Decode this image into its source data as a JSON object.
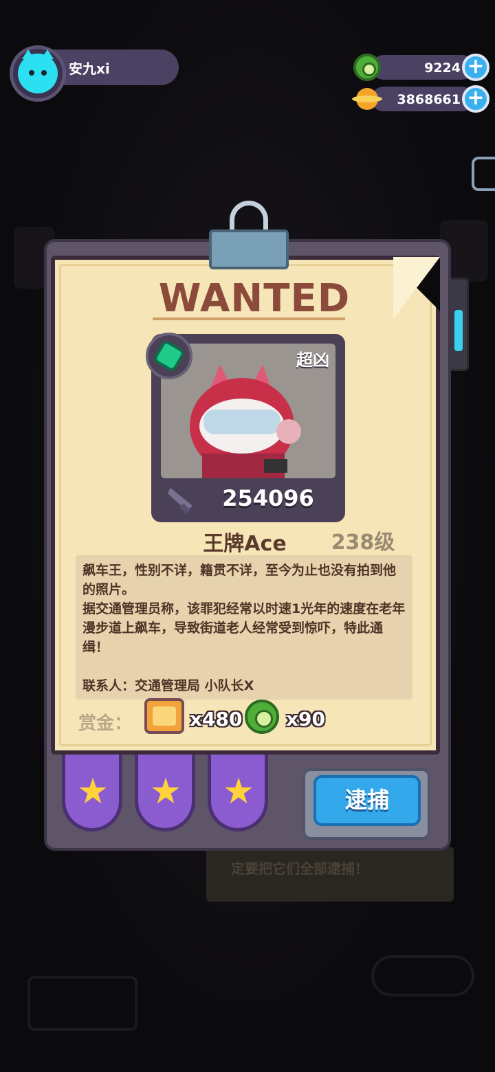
{
  "player": {
    "name": "安九xi"
  },
  "currencies": [
    {
      "name": "green-coin",
      "value": "9224"
    },
    {
      "name": "planet-coin",
      "value": "3868661"
    }
  ],
  "poster": {
    "heading": "WANTED",
    "tier": "超凶",
    "power": "254096",
    "character_name": "王牌Ace",
    "level": "238级",
    "description": "飙车王，性别不详，籍贯不详，至今为止也没有拍到他的照片。\n据交通管理员称，该罪犯经常以时速1光年的速度在老年漫步道上飙车，导致街道老人经常受到惊吓，特此通缉！\n\n联系人：交通管理局 小队长X",
    "reward_label": "赏金：",
    "rewards": [
      {
        "icon": "chip-icon",
        "qty": "x480"
      },
      {
        "icon": "green-coin-icon",
        "qty": "x90"
      }
    ],
    "stars": 3,
    "arrest_label": "逮捕"
  },
  "background": {
    "note_text": "定要把它们全部逮捕！"
  },
  "colors": {
    "paper": "#f5e5b7",
    "panel": "#5e5668",
    "arrest_button": "#33a9ec",
    "star": "#ffd23a"
  }
}
